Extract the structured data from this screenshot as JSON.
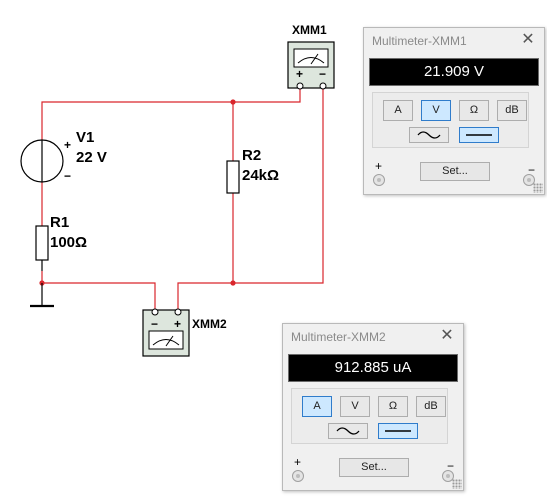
{
  "schematic": {
    "components": [
      {
        "id": "V1",
        "name": "V1",
        "value": "22 V"
      },
      {
        "id": "R1",
        "name": "R1",
        "value": "100Ω"
      },
      {
        "id": "R2",
        "name": "R2",
        "value": "24kΩ"
      },
      {
        "id": "XMM1",
        "name": "XMM1"
      },
      {
        "id": "XMM2",
        "name": "XMM2"
      }
    ],
    "source_plus": "+",
    "source_minus": "−",
    "meter_plus": "+",
    "meter_minus": "−"
  },
  "multimeters": [
    {
      "id": "xmm1",
      "title": "Multimeter-XMM1",
      "close_glyph": "✕",
      "reading": "21.909 V",
      "modes": [
        "A",
        "V",
        "Ω",
        "dB"
      ],
      "active_mode": "V",
      "waveforms": [
        "ac",
        "dc"
      ],
      "active_waveform": "dc",
      "plus": "+",
      "minus": "−",
      "set_label": "Set..."
    },
    {
      "id": "xmm2",
      "title": "Multimeter-XMM2",
      "close_glyph": "✕",
      "reading": "912.885 uA",
      "modes": [
        "A",
        "V",
        "Ω",
        "dB"
      ],
      "active_mode": "A",
      "waveforms": [
        "ac",
        "dc"
      ],
      "active_waveform": "dc",
      "plus": "+",
      "minus": "−",
      "set_label": "Set..."
    }
  ],
  "colors": {
    "wire": "#d9262c",
    "component": "#000000",
    "junction": "#d9262c",
    "meter_body": "#dde6dd",
    "active_button": "#cde8ff",
    "active_border": "#2f7ccb"
  }
}
